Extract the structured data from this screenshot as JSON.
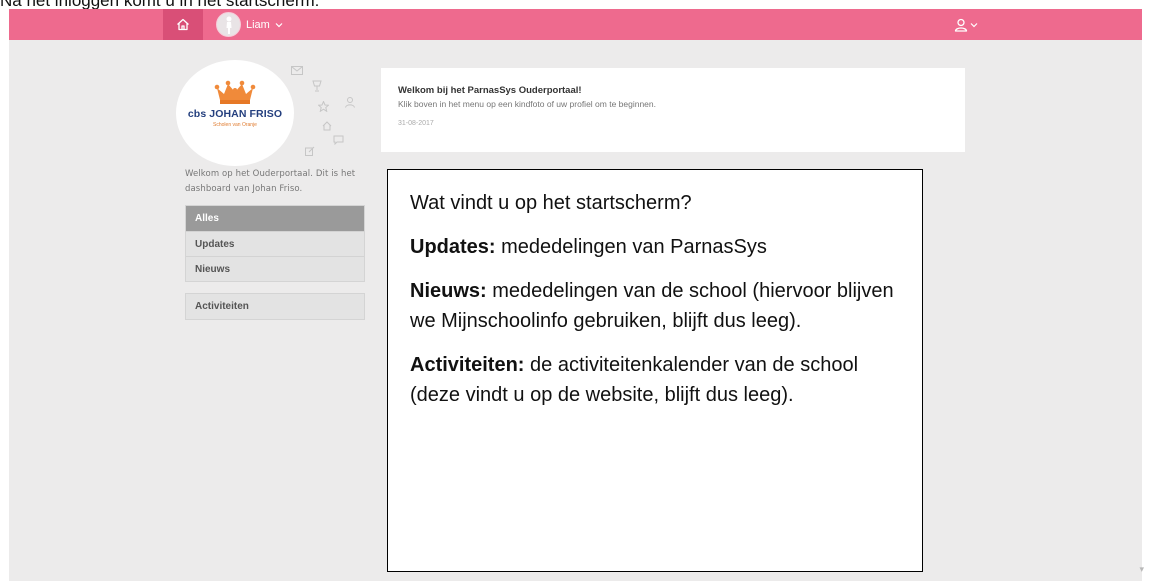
{
  "caption": "Na het inloggen komt u in het startscherm:",
  "topbar": {
    "child_name": "Liam",
    "colors": {
      "bar": "#ee6a8e",
      "home_active": "#d94f77"
    }
  },
  "icons": {
    "home": "home-icon",
    "child_avatar": "child-avatar-icon",
    "profile": "user-icon",
    "chevron": "chevron-down-icon"
  },
  "school": {
    "name": "cbs JOHAN FRISO",
    "tagline": "Scholen van Oranje"
  },
  "sidebar": {
    "welcome": "Welkom op het Ouderportaal. Dit is het dashboard van Johan Friso.",
    "filters": [
      {
        "label": "Alles",
        "active": true
      },
      {
        "label": "Updates",
        "active": false
      },
      {
        "label": "Nieuws",
        "active": false
      }
    ],
    "activities_label": "Activiteiten"
  },
  "message": {
    "title": "Welkom bij het ParnasSys Ouderportaal!",
    "body": "Klik boven in het menu op een kindfoto of uw profiel om te beginnen.",
    "date": "31-08-2017"
  },
  "annotation": {
    "question": "Wat vindt u op het startscherm?",
    "items": [
      {
        "term": "Updates:",
        "text": " mededelingen van ParnasSys"
      },
      {
        "term": "Nieuws:",
        "text": " mededelingen van de school (hiervoor blijven we Mijnschoolinfo gebruiken, blijft dus leeg)."
      },
      {
        "term": "Activiteiten:",
        "text": " de activiteitenkalender van de school (deze vindt u op de website, blijft dus leeg)."
      }
    ]
  }
}
